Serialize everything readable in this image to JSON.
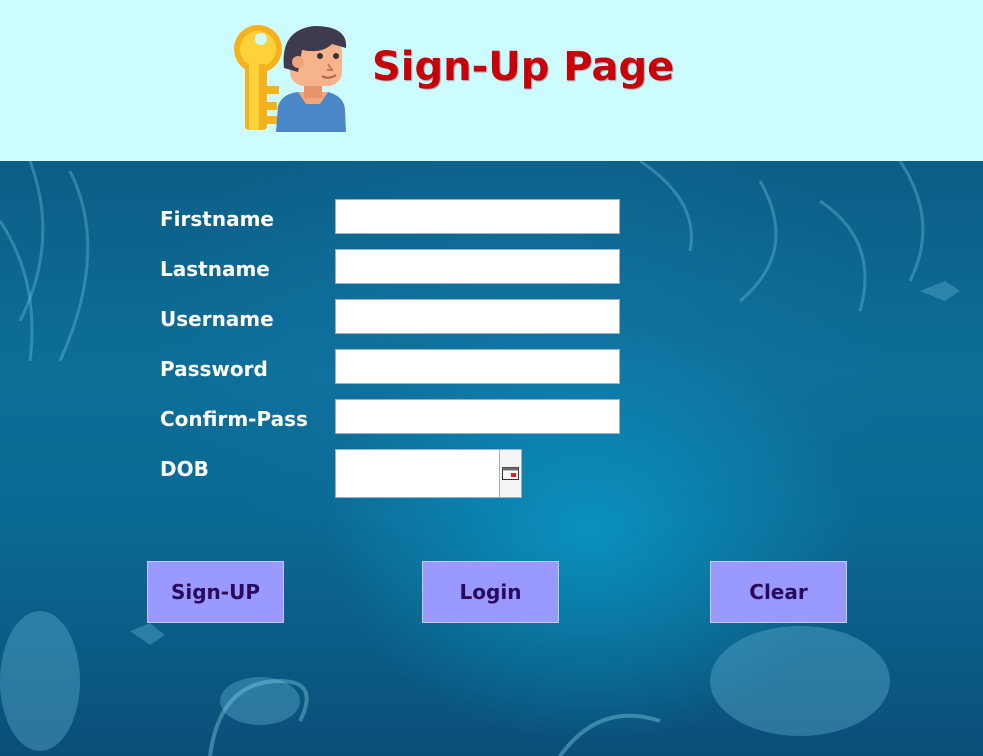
{
  "header": {
    "title": "Sign-Up Page",
    "logo_icon": "key-and-user-icon",
    "background_color": "#ccfcff",
    "title_color": "#c8000a"
  },
  "form": {
    "fields": [
      {
        "label": "Firstname",
        "value": "",
        "placeholder": ""
      },
      {
        "label": "Lastname",
        "value": "",
        "placeholder": ""
      },
      {
        "label": "Username",
        "value": "",
        "placeholder": ""
      },
      {
        "label": "Password",
        "value": "",
        "placeholder": ""
      },
      {
        "label": "Confirm-Pass",
        "value": "",
        "placeholder": ""
      }
    ],
    "dob": {
      "label": "DOB",
      "value": "",
      "picker_icon": "calendar-icon"
    }
  },
  "buttons": {
    "signup": "Sign-UP",
    "login": "Login",
    "clear": "Clear",
    "button_color": "#9999ff",
    "button_text_color": "#2a0a5c"
  },
  "theme": {
    "background_primary": "#0b6a95",
    "label_color": "#ffffff"
  }
}
